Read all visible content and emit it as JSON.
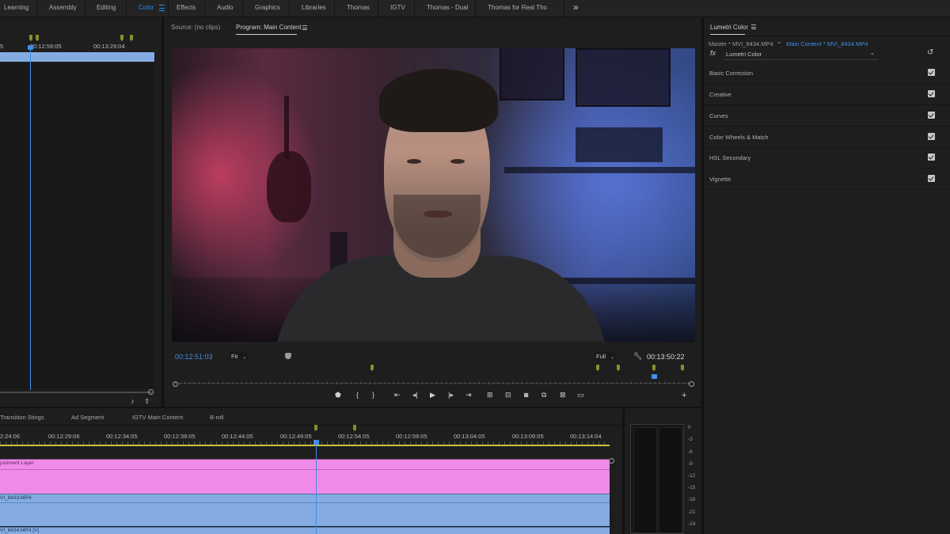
{
  "workspaces": {
    "tabs": [
      {
        "label": "Learning"
      },
      {
        "label": "Assembly"
      },
      {
        "label": "Editing"
      },
      {
        "label": "Color",
        "active": true
      },
      {
        "label": "Effects"
      },
      {
        "label": "Audio"
      },
      {
        "label": "Graphics"
      },
      {
        "label": "Libraries"
      },
      {
        "label": "Thomas"
      },
      {
        "label": "IGTV"
      },
      {
        "label": "Thomas - Dual"
      },
      {
        "label": "Thomas for Real Tho"
      }
    ],
    "overflow_icon": "double-chevron-right"
  },
  "source_timeline": {
    "timecodes": [
      "5",
      "00:12:59:05",
      "00:13:29:04"
    ],
    "icons": [
      "music-icon",
      "export-icon"
    ]
  },
  "program_monitor": {
    "source_tab": "Source: (no clips)",
    "program_tab": "Program: Main Content",
    "current_timecode": "00:12:51:03",
    "zoom": "Fit",
    "resolution": "Full",
    "duration_timecode": "00:13:50:22",
    "transport_icons": [
      "add-marker",
      "mark-in",
      "mark-out",
      "go-to-in",
      "step-back",
      "play",
      "step-forward",
      "go-to-out",
      "insert",
      "overwrite",
      "export-frame",
      "comparison-view",
      "lift",
      "extract",
      "add-button"
    ]
  },
  "lumetri": {
    "panel_title": "Lumetri Color",
    "master_clip": "Master * MVI_8434.MP4",
    "sequence_clip": "Main Content * MVI_8434.MP4",
    "effect_name": "Lumetri Color",
    "sections": [
      {
        "label": "Basic Correction",
        "enabled": true
      },
      {
        "label": "Creative",
        "enabled": true
      },
      {
        "label": "Curves",
        "enabled": true
      },
      {
        "label": "Color Wheels & Match",
        "enabled": true
      },
      {
        "label": "HSL Secondary",
        "enabled": true
      },
      {
        "label": "Vignette",
        "enabled": true
      }
    ]
  },
  "sequence": {
    "tabs": [
      {
        "label": "Transition Stings"
      },
      {
        "label": "Ad Segment"
      },
      {
        "label": "IGTV Main Content"
      },
      {
        "label": "B-roll"
      }
    ],
    "timecodes": [
      "2:24:06",
      "00:12:29:06",
      "00:12:34:05",
      "00:12:39:05",
      "00:12:44:05",
      "00:12:49:05",
      "00:12:54:05",
      "00:12:59:05",
      "00:13:04:05",
      "00:13:09:05",
      "00:13:14:04"
    ],
    "clips": {
      "adjustment": "justment Layer",
      "clip_a": "VI_8433.MP4",
      "clip_b": "VI_8434.MP4 [V]"
    }
  },
  "audio_meter": {
    "labels": [
      "0",
      "-3",
      "-6",
      "-9",
      "-12",
      "-15",
      "-18",
      "-21",
      "-24"
    ]
  },
  "colors": {
    "accent": "#2d8ceb",
    "adjustment_layer": "#f08ae8",
    "video_clip": "#84ace3",
    "marker": "#8a8d2b"
  }
}
